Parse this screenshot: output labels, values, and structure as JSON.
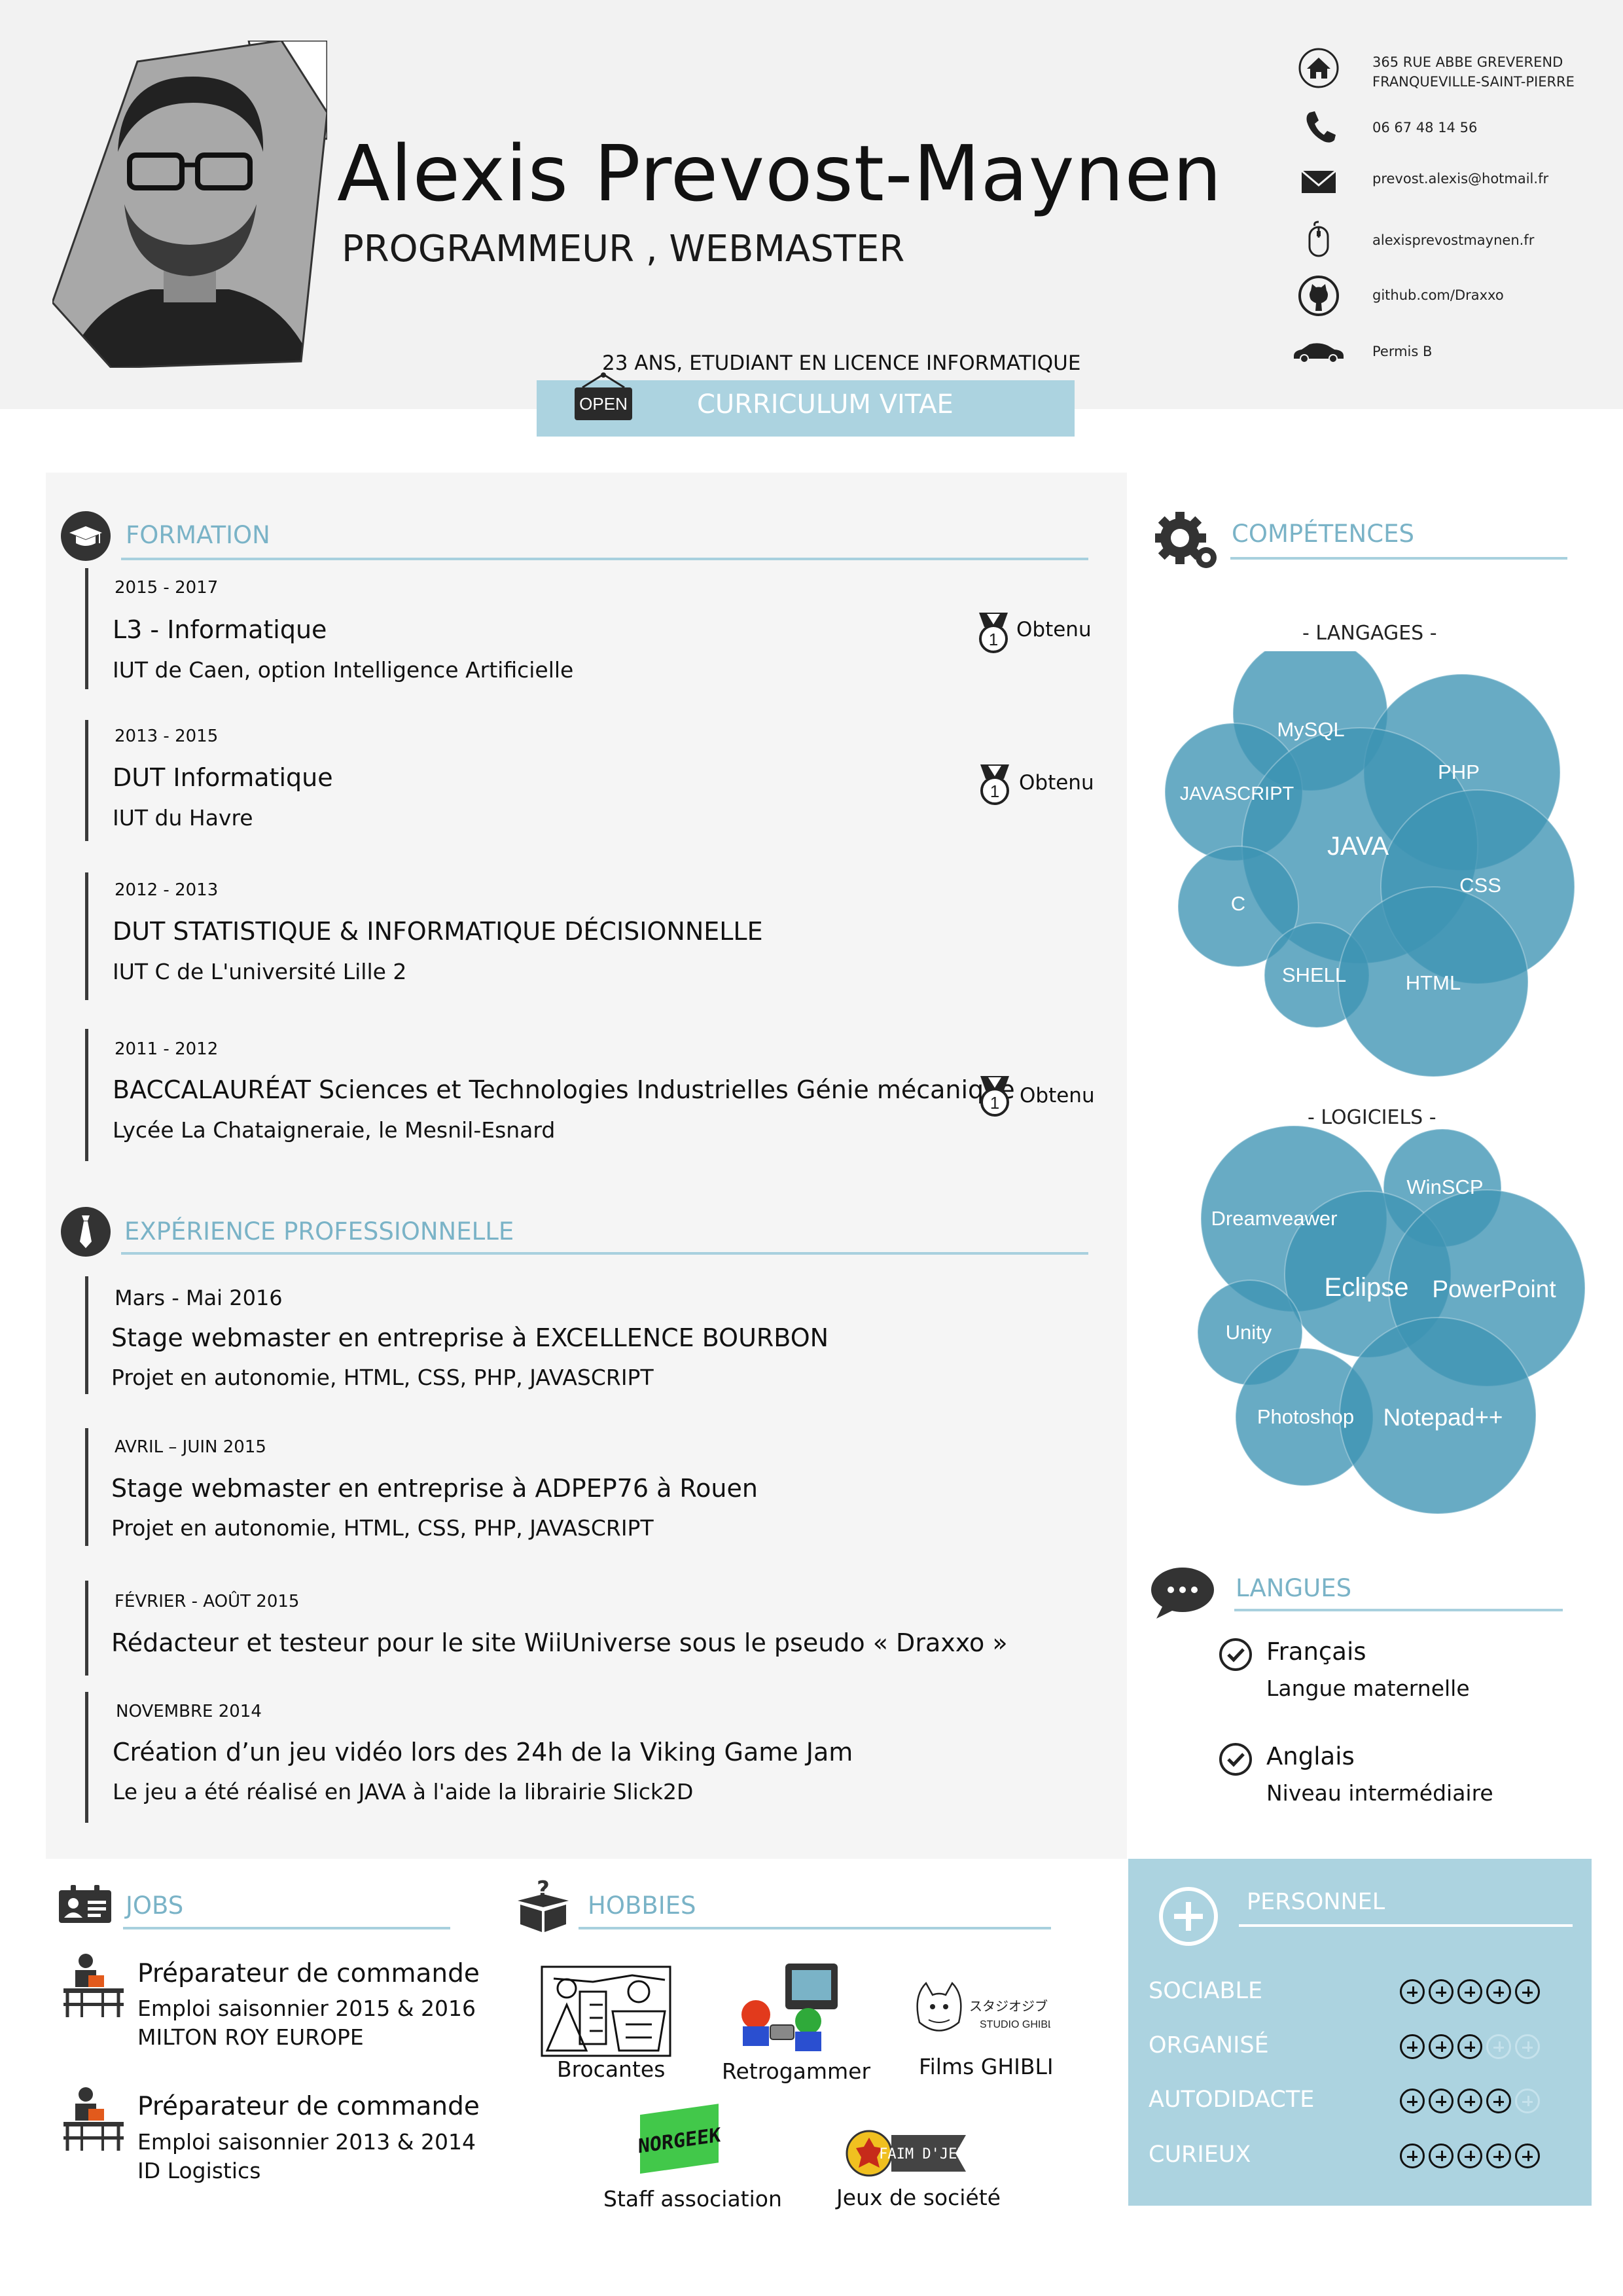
{
  "header": {
    "name": "Alexis Prevost-Maynen",
    "subtitle": "PROGRAMMEUR , WEBMASTER",
    "age_line": "23 ANS, ETUDIANT EN LICENCE INFORMATIQUE",
    "cv_title": "CURRICULUM VITAE",
    "open_sign": "OPEN"
  },
  "contact": [
    {
      "icon": "home-icon",
      "lines": [
        "365 RUE ABBE GREVEREND",
        "FRANQUEVILLE-SAINT-PIERRE"
      ]
    },
    {
      "icon": "phone-icon",
      "lines": [
        "06  67 48 14 56"
      ]
    },
    {
      "icon": "envelope-icon",
      "lines": [
        "prevost.alexis@hotmail.fr"
      ]
    },
    {
      "icon": "mouse-icon",
      "lines": [
        "alexisprevostmaynen.fr"
      ]
    },
    {
      "icon": "github-icon",
      "lines": [
        "github.com/Draxxo"
      ]
    },
    {
      "icon": "car-icon",
      "lines": [
        "Permis B"
      ]
    }
  ],
  "formation": {
    "title": "FORMATION",
    "icon": "graduation-cap-icon",
    "entries": [
      {
        "date": "2015 - 2017",
        "title": "L3 - Informatique",
        "sub": "IUT de Caen, option Intelligence Artificielle",
        "status": "Obtenu"
      },
      {
        "date": "2013 - 2015",
        "title": "DUT Informatique",
        "sub": "IUT du Havre",
        "status": "Obtenu"
      },
      {
        "date": "2012 - 2013",
        "title": "DUT STATISTIQUE & INFORMATIQUE DÉCISIONNELLE",
        "sub": "IUT C de L'université Lille 2",
        "status": ""
      },
      {
        "date": "2011 - 2012",
        "title": "BACCALAURÉAT Sciences et Technologies Industrielles Génie mécanique",
        "sub": "Lycée La Chataigneraie, le Mesnil-Esnard",
        "status": "Obtenu"
      }
    ],
    "medal_number": "1"
  },
  "experience": {
    "title": "EXPÉRIENCE PROFESSIONNELLE",
    "icon": "tie-icon",
    "entries": [
      {
        "date": "Mars - Mai 2016",
        "title": "Stage webmaster en entreprise à EXCELLENCE BOURBON",
        "sub": "Projet en autonomie, HTML, CSS, PHP, JAVASCRIPT"
      },
      {
        "date": "AVRIL – JUIN 2015",
        "title": "Stage webmaster en entreprise à ADPEP76 à Rouen",
        "sub": "Projet en autonomie, HTML, CSS, PHP, JAVASCRIPT"
      },
      {
        "date": "FÉVRIER - AOÛT 2015",
        "title": "Rédacteur et testeur pour le site WiiUniverse sous le pseudo « Draxxo »",
        "sub": ""
      },
      {
        "date": "NOVEMBRE 2014",
        "title": "Création d’un jeu vidéo lors des 24h de la Viking Game Jam",
        "sub": "Le jeu a été réalisé en JAVA à l'aide la librairie Slick2D"
      }
    ]
  },
  "competences": {
    "title": "COMPÉTENCES",
    "icon": "gears-icon",
    "bubble_color": "#3d93b4",
    "languages_label": "- LANGAGES -",
    "languages": [
      "MySQL",
      "PHP",
      "JAVASCRIPT",
      "JAVA",
      "CSS",
      "C",
      "SHELL",
      "HTML"
    ],
    "software_label": "- LOGICIELS -",
    "software": [
      "WinSCP",
      "Dreamveawer",
      "Eclipse",
      "PowerPoint",
      "Unity",
      "Photoshop",
      "Notepad++"
    ]
  },
  "langues": {
    "title": "LANGUES",
    "icon": "speech-bubble-icon",
    "items": [
      {
        "name": "Français",
        "level": "Langue maternelle"
      },
      {
        "name": "Anglais",
        "level": "Niveau intermédiaire"
      }
    ]
  },
  "jobs": {
    "title": "JOBS",
    "icon": "id-badge-icon",
    "items": [
      {
        "title": "Préparateur de commande",
        "line1": "Emploi saisonnier 2015 & 2016",
        "line2": "MILTON ROY EUROPE"
      },
      {
        "title": "Préparateur de commande",
        "line1": "Emploi saisonnier 2013 & 2014",
        "line2": "ID Logistics"
      }
    ]
  },
  "hobbies": {
    "title": "HOBBIES",
    "icon": "mystery-box-icon",
    "items": [
      "Brocantes",
      "Retrogammer",
      "Films GHIBLI",
      "Staff association",
      "Jeux de société"
    ],
    "ghibli_logo_text": "STUDIO GHIBLI",
    "ghibli_logo_jp": "スタジオジブリ作品",
    "staff_logo_text": "NORGEEK",
    "jeux_logo_text": "FAIM D'JEUX"
  },
  "personnel": {
    "title": "PERSONNEL",
    "icon": "plus-circle-icon",
    "traits": [
      {
        "name": "SOCIABLE",
        "rating": 5,
        "max": 5
      },
      {
        "name": "ORGANISÉ",
        "rating": 3,
        "max": 5
      },
      {
        "name": "AUTODIDACTE",
        "rating": 4,
        "max": 5
      },
      {
        "name": "CURIEUX",
        "rating": 5,
        "max": 5
      }
    ]
  }
}
